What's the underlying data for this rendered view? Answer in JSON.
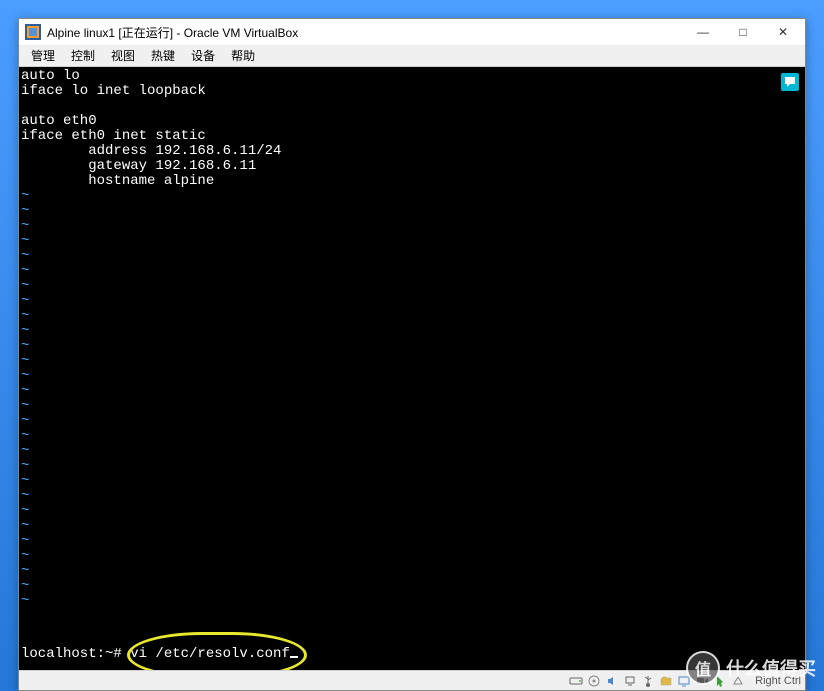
{
  "window": {
    "title": "Alpine linux1 [正在运行] - Oracle VM VirtualBox"
  },
  "menubar": {
    "items": [
      "管理",
      "控制",
      "视图",
      "热键",
      "设备",
      "帮助"
    ]
  },
  "terminal": {
    "lines": [
      "auto lo",
      "iface lo inet loopback",
      "",
      "auto eth0",
      "iface eth0 inet static",
      "        address 192.168.6.11/24",
      "        gateway 192.168.6.11",
      "        hostname alpine"
    ],
    "tilde": "~",
    "prompt": "localhost:~# ",
    "command": "vi /etc/resolv.conf"
  },
  "statusbar": {
    "host_key": "Right Ctrl"
  },
  "watermark": {
    "logo": "值",
    "text": "什么值得买"
  },
  "icons": {
    "minimize": "—",
    "maximize": "□",
    "close": "✕",
    "notification": "💬"
  }
}
